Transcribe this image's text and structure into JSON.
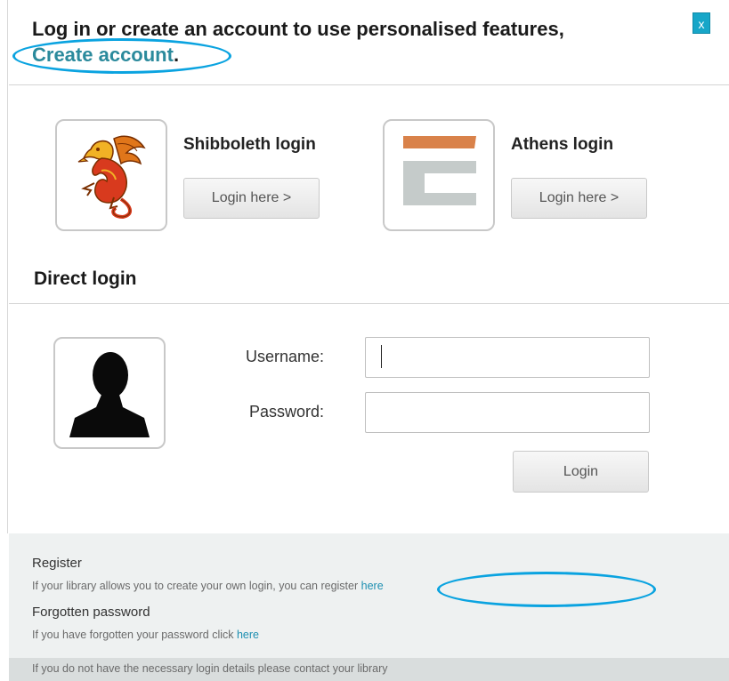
{
  "header": {
    "intro": "Log in or create an account to use personalised features,",
    "create_account_link": "Create account",
    "period": ".",
    "close_label": "x"
  },
  "providers": [
    {
      "title": "Shibboleth login",
      "button_label": "Login here >",
      "icon": "shibboleth-griffin-icon"
    },
    {
      "title": "Athens login",
      "button_label": "Login here >",
      "icon": "athens-logo-icon"
    }
  ],
  "direct_login": {
    "title": "Direct login",
    "avatar_icon": "user-silhouette-icon",
    "username_label": "Username:",
    "username_value": "",
    "password_label": "Password:",
    "password_value": "",
    "login_button": "Login"
  },
  "footer": {
    "register_title": "Register",
    "register_text": "If your library allows you to create your own login, you can register ",
    "register_link": "here",
    "forgot_title": "Forgotten password",
    "forgot_text": "If you have forgotten your password click ",
    "forgot_link": "here",
    "contact_text": "If you do not have the necessary login details please contact your library"
  },
  "colors": {
    "link": "#2b8a9c",
    "close_button": "#17a6c8",
    "callout": "#0aa3e0",
    "footer_bg": "#eef1f1",
    "athens_orange": "#d9824a",
    "athens_gray": "#c5cbca"
  }
}
